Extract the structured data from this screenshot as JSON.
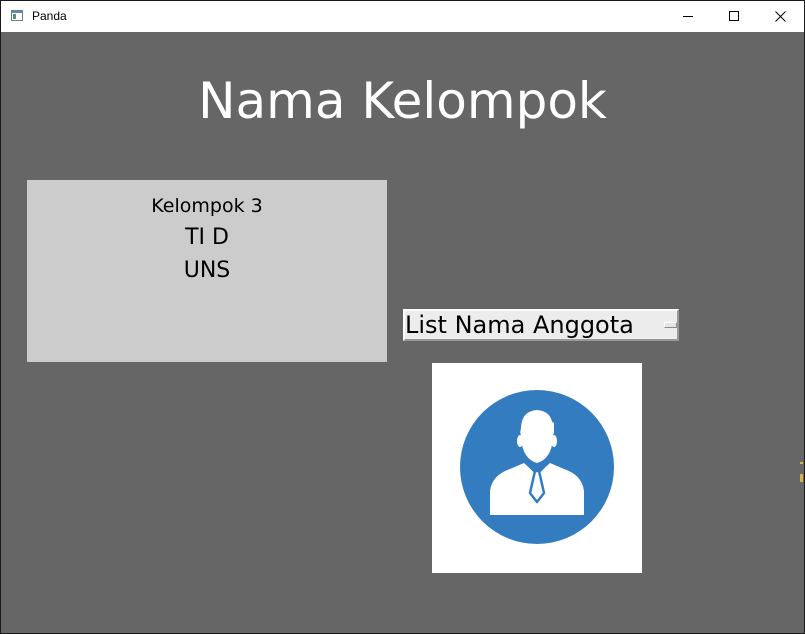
{
  "window": {
    "title": "Panda",
    "app_icon": "window-app-icon",
    "controls": {
      "minimize_icon": "minimize-icon",
      "maximize_icon": "maximize-icon",
      "close_icon": "close-icon"
    }
  },
  "main": {
    "heading": "Nama Kelompok",
    "info": {
      "line1": "Kelompok 3",
      "line2": "TI D",
      "line3": "UNS"
    },
    "members_dropdown": {
      "selected": "List Nama Anggota"
    },
    "avatar": {
      "icon": "person-avatar-icon",
      "accent_color": "#347CC0"
    }
  },
  "colors": {
    "background": "#666666",
    "panel": "#CCCCCC",
    "heading_text": "#FFFFFF"
  }
}
